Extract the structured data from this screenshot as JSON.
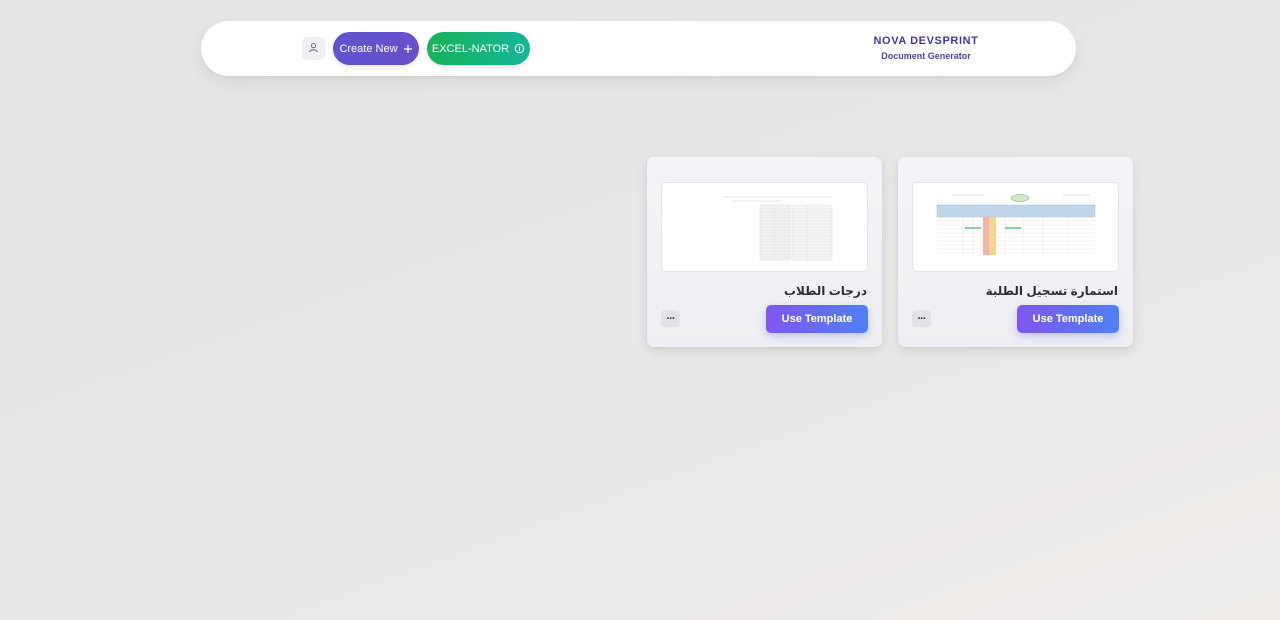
{
  "header": {
    "create_new_label": "Create New",
    "excel_nator_label": "EXCEL-NATOR",
    "brand_title": "NOVA DEVSPRINT",
    "brand_subtitle": "Document Generator",
    "icons": {
      "user": "user-icon",
      "create": "plus-icon",
      "excel": "info-icon"
    }
  },
  "templates": [
    {
      "name": "درجات الطلاب",
      "action_label": "Use Template",
      "more_label": "···"
    },
    {
      "name": "استمارة تسجيل الطلبة",
      "action_label": "Use Template",
      "more_label": "···"
    }
  ],
  "colors": {
    "create_gradient": [
      "#5b55cf",
      "#6a4fc9"
    ],
    "excel_gradient": [
      "#17b257",
      "#15b69a"
    ],
    "use_template_gradient": [
      "#8056f0",
      "#4f80f3"
    ],
    "brand": "#3c3aa0"
  }
}
